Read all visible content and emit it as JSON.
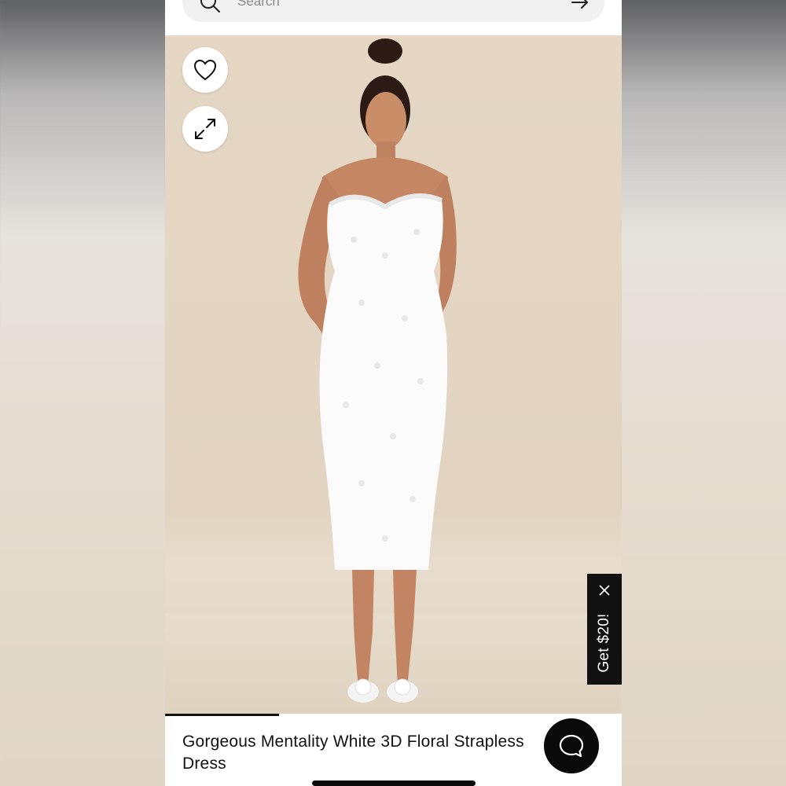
{
  "search": {
    "placeholder": "Search"
  },
  "hero": {
    "favorite_icon": "heart-outline-icon",
    "expand_icon": "expand-arrows-icon",
    "image_progress": 0.25
  },
  "promo": {
    "label": "Get $20!",
    "close_icon": "close-icon"
  },
  "product": {
    "title": "Gorgeous Mentality White 3D Floral Strapless Dress"
  },
  "chat": {
    "icon": "chat-bubble-icon"
  },
  "colors": {
    "hero_bg": "#e5d7c4",
    "promo_bg": "#111111",
    "chat_bg": "#0a0a0a"
  }
}
